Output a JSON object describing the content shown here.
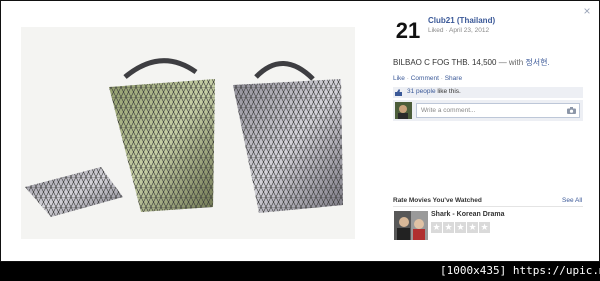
{
  "post": {
    "page_name": "Club21 (Thailand)",
    "liked": "Liked",
    "date": "April 23, 2012",
    "caption_main": "BILBAO C FOG THB. 14,500",
    "caption_with": "— with",
    "caption_tag": "정서현.",
    "actions": {
      "like": "Like",
      "comment": "Comment",
      "share": "Share",
      "sep": "·"
    },
    "likes_count": "31 people",
    "likes_suffix": "like this.",
    "comment_placeholder": "Write a comment..."
  },
  "logo_text": "21",
  "close_symbol": "×",
  "sidebar": {
    "rate_heading": "Rate Movies You've Watched",
    "see_all": "See All",
    "movie_title": "Shark - Korean Drama",
    "stars": [
      "★",
      "★",
      "★",
      "★",
      "★"
    ]
  },
  "watermark": "[1000x435] https://upic.me/",
  "colors": {
    "link": "#3b5998",
    "panel": "#edeff4"
  }
}
